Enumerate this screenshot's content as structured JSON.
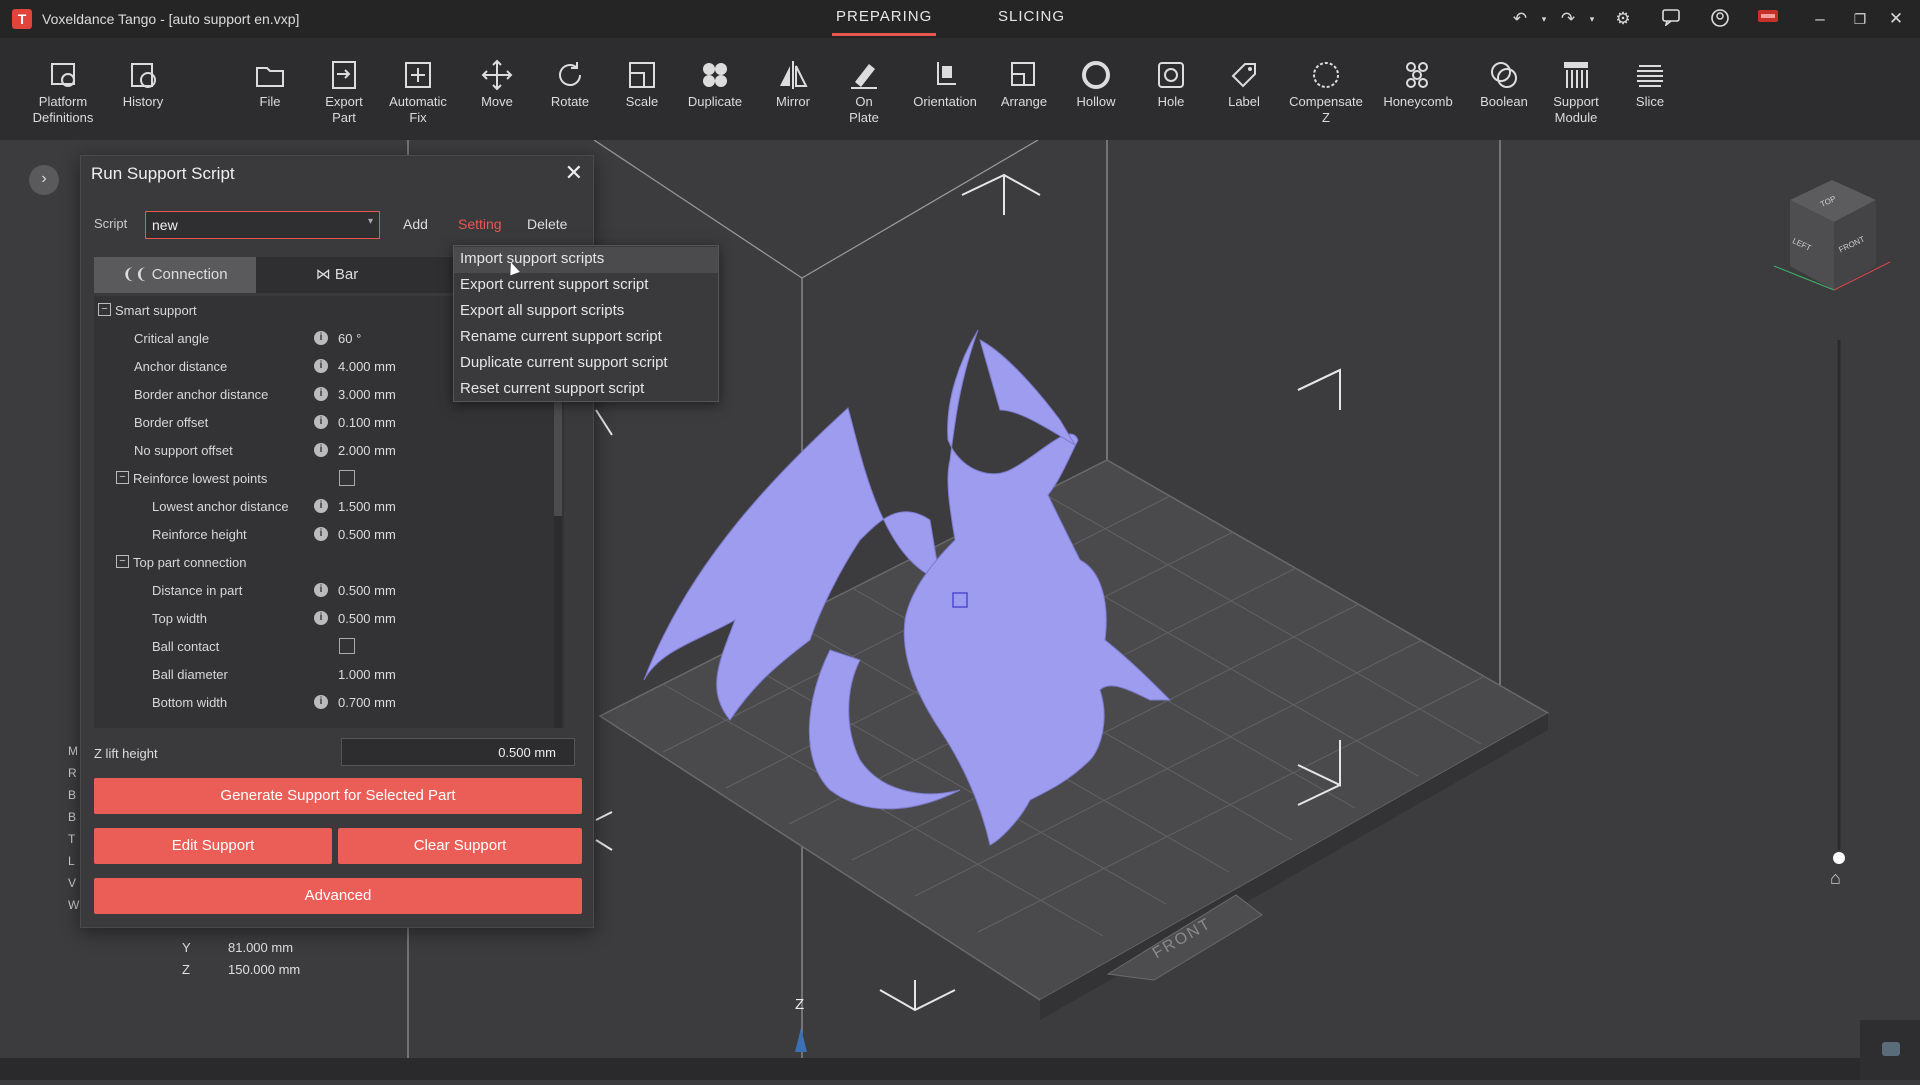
{
  "window": {
    "title": "Voxeldance Tango - [auto support en.vxp]",
    "logo_letter": "T",
    "modes": [
      "PREPARING",
      "SLICING"
    ]
  },
  "toolbar": [
    {
      "label": "Platform\nDefinitions",
      "icon": "platform-gear-icon"
    },
    {
      "label": "History",
      "icon": "history-icon"
    },
    {
      "label": "File",
      "icon": "folder-icon"
    },
    {
      "label": "Export\nPart",
      "icon": "export-icon"
    },
    {
      "label": "Automatic\nFix",
      "icon": "auto-fix-icon"
    },
    {
      "label": "Move",
      "icon": "move-icon"
    },
    {
      "label": "Rotate",
      "icon": "rotate-icon"
    },
    {
      "label": "Scale",
      "icon": "scale-icon"
    },
    {
      "label": "Duplicate",
      "icon": "duplicate-icon"
    },
    {
      "label": "Mirror",
      "icon": "mirror-icon"
    },
    {
      "label": "On\nPlate",
      "icon": "on-plate-icon"
    },
    {
      "label": "Orientation",
      "icon": "orientation-icon"
    },
    {
      "label": "Arrange",
      "icon": "arrange-icon"
    },
    {
      "label": "Hollow",
      "icon": "hollow-icon"
    },
    {
      "label": "Hole",
      "icon": "hole-icon"
    },
    {
      "label": "Label",
      "icon": "label-icon"
    },
    {
      "label": "Compensate\nZ",
      "icon": "compensate-z-icon"
    },
    {
      "label": "Honeycomb",
      "icon": "honeycomb-icon"
    },
    {
      "label": "Boolean",
      "icon": "boolean-icon"
    },
    {
      "label": "Support\nModule",
      "icon": "support-module-icon"
    },
    {
      "label": "Slice",
      "icon": "slice-icon"
    }
  ],
  "dialog": {
    "title": "Run Support Script",
    "close": "✕",
    "script_label": "Script",
    "script_value": "new",
    "add": "Add",
    "setting": "Setting",
    "delete": "Delete",
    "tabs": [
      "Connection",
      "Bar"
    ],
    "params": [
      {
        "type": "group",
        "label": "Smart support",
        "indent": 0
      },
      {
        "label": "Critical angle",
        "value": "60 °",
        "indent": 1,
        "info": true
      },
      {
        "label": "Anchor distance",
        "value": "4.000 mm",
        "indent": 1,
        "info": true
      },
      {
        "label": "Border anchor distance",
        "value": "3.000 mm",
        "indent": 1,
        "info": true
      },
      {
        "label": "Border offset",
        "value": "0.100 mm",
        "indent": 1,
        "info": true
      },
      {
        "label": "No support offset",
        "value": "2.000 mm",
        "indent": 1,
        "info": true
      },
      {
        "type": "group",
        "label": "Reinforce lowest points",
        "indent": 1,
        "checkbox": true
      },
      {
        "label": "Lowest anchor distance",
        "value": "1.500 mm",
        "indent": 2,
        "info": true
      },
      {
        "label": "Reinforce height",
        "value": "0.500 mm",
        "indent": 2,
        "info": true
      },
      {
        "type": "group",
        "label": "Top part connection",
        "indent": 1
      },
      {
        "label": "Distance in part",
        "value": "0.500 mm",
        "indent": 2,
        "info": true
      },
      {
        "label": "Top width",
        "value": "0.500 mm",
        "indent": 2,
        "info": true
      },
      {
        "label": "Ball contact",
        "indent": 2,
        "checkbox": true
      },
      {
        "label": "Ball diameter",
        "value": "1.000 mm",
        "indent": 2
      },
      {
        "label": "Bottom width",
        "value": "0.700 mm",
        "indent": 2,
        "info": true
      }
    ],
    "zlift_label": "Z lift height",
    "zlift_value": "0.500 mm",
    "generate": "Generate Support for Selected Part",
    "edit": "Edit Support",
    "clear": "Clear Support",
    "advanced": "Advanced"
  },
  "menu": [
    "Import support scripts",
    "Export current support script",
    "Export all support scripts",
    "Rename current support script",
    "Duplicate current support script",
    "Reset current support script"
  ],
  "platform_info": {
    "y_label": "Y",
    "y_value": "81.000 mm",
    "z_label": "Z",
    "z_value": "150.000 mm",
    "side_letters": [
      "M",
      "R",
      "B",
      "B",
      "T",
      "L",
      "V",
      "W"
    ]
  },
  "viewport": {
    "axis_z": "Z",
    "front_label": "FRONT",
    "cube_top": "TOP",
    "cube_left": "LEFT",
    "cube_front": "FRONT",
    "model_color": "#9d9cef",
    "accent": "#e8574f"
  }
}
